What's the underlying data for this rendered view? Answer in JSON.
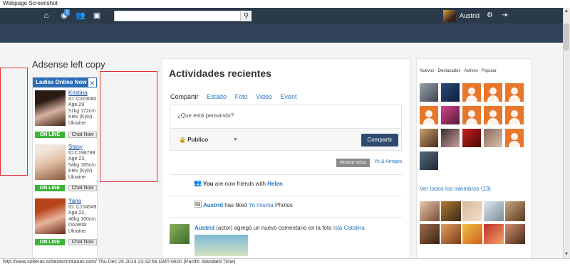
{
  "window_title": "Webpage Screenshot",
  "topbar": {
    "badge_count": "1",
    "search_placeholder": "",
    "user_name": "Austrid"
  },
  "left": {
    "adsense_title": "Adsense left copy",
    "widget_title": "Ladies Online Now",
    "profiles": [
      {
        "name": "Kristina",
        "id": "ID: C319080",
        "age": "Age 29",
        "stats": "51kg 172cm",
        "city": "Kiev (Kyiv)",
        "country": "Ukraine",
        "status": "ON LINE",
        "chat": "Chat Now"
      },
      {
        "name": "Stasy",
        "id": "ID:C198789",
        "age": "Age 23,",
        "stats": "54kg 165cm",
        "city": "Kiev (Kyiv)",
        "country": "Ukraine",
        "status": "ON LINE",
        "chat": "Chat Now"
      },
      {
        "name": "Yana",
        "id": "ID: C154549",
        "age": "Age 22,",
        "stats": "46kg 160cm",
        "city": "Donetsk",
        "country": "Ukraine",
        "status": "ON LINE",
        "chat": "Chat Now"
      }
    ]
  },
  "main": {
    "title": "Actividades recientes",
    "tabs": {
      "share": "Compartir",
      "status": "Estado",
      "photo": "Foto",
      "video": "Video",
      "event": "Event"
    },
    "composer_placeholder": "¿Que está pensando?",
    "privacy": "Publico",
    "share_button": "Compartir",
    "show_all": "Mostrar todos",
    "me_and_friends": "Yo & Amigos",
    "feed": [
      {
        "you": "You",
        "text": "are now friends with",
        "target": "Helen"
      },
      {
        "actor": "Austrid",
        "text": "has liked",
        "target": "Yo misma",
        "suffix": "Photos"
      }
    ],
    "comment": {
      "actor": "Austrid",
      "text": "(actor) agregó un nuevo comentario en la foto",
      "target": "Isla Catalina"
    }
  },
  "right": {
    "tabs": "Nuevos · Destacados · Activos · Popular",
    "see_all": "Ver todos los miembros (13)"
  },
  "status_bar": "http://www.solteras.solterascristianas.com/  Thu Dec 26 2013 23:32:58 GMT-0800 (Pacific Standard Time)",
  "colors": {
    "topbar": "#2b3a4a",
    "accent": "#2a78c2",
    "online": "#3cb43c",
    "widget_head": "#2a6db5"
  }
}
